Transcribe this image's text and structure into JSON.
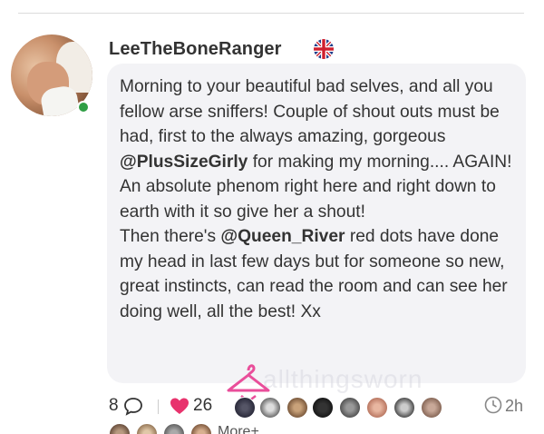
{
  "post": {
    "author": "LeeTheBoneRanger",
    "country_flag_icon": "uk-flag-icon",
    "online": true,
    "body": {
      "line1": "Morning to your beautiful bad selves, and all you fellow arse sniffers! Couple of shout outs must be had, first to the always amazing, gorgeous ",
      "mention1": "@PlusSizeGirly",
      "line2": " for making my morning.... AGAIN! An absolute phenom right here and right down to earth with it so give her a shout!",
      "line3": "Then there's ",
      "mention2": "@Queen_River",
      "line4": " red dots have done my head in last few days but for someone so new, great instincts, can read the room and can see her doing well, all the best! Xx"
    }
  },
  "footer": {
    "comment_count": "8",
    "like_count": "26",
    "time": "2h",
    "more_label": "More+"
  },
  "watermark": "allthingsworn",
  "colors": {
    "heart": "#e8336d",
    "online": "#2f9e44",
    "bubble": "#f3f3f6",
    "hanger": "#e94e9a"
  }
}
